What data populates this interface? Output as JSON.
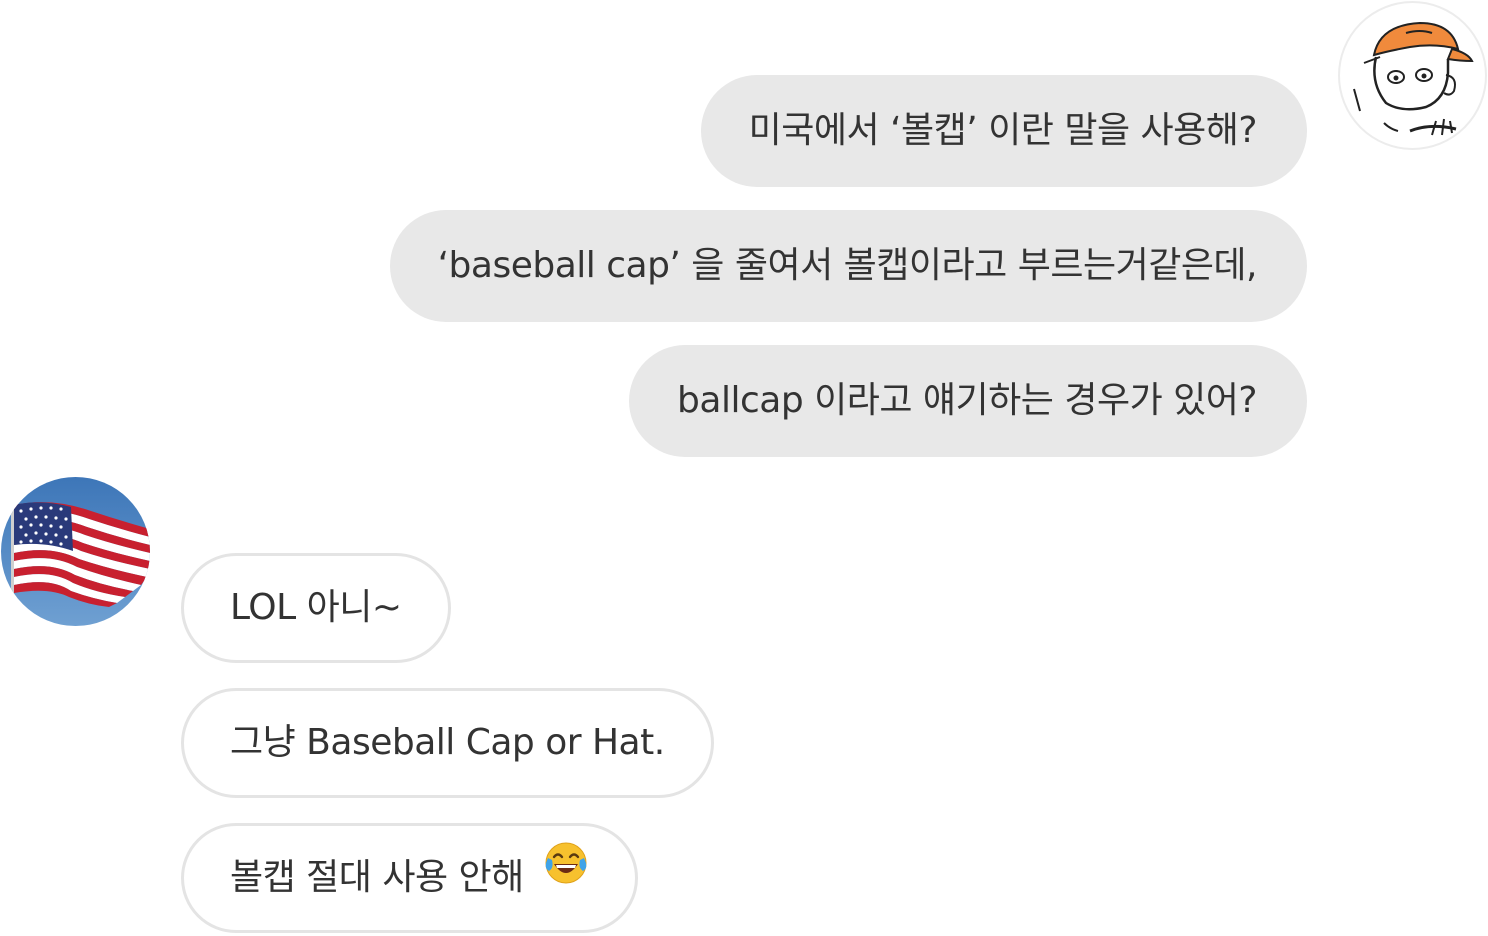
{
  "conversation": {
    "sent_messages": [
      "미국에서 ‘볼캡’ 이란 말을 사용해?",
      "‘baseball cap’ 을 줄여서 볼캡이라고 부르는거같은데,",
      "ballcap 이라고 얘기하는 경우가 있어?"
    ],
    "received_messages": [
      "LOL 아니~",
      "그냥 Baseball Cap or Hat.",
      "볼캡 절대 사용 안해"
    ],
    "received_last_emoji": "face-with-tears-of-joy-icon"
  },
  "avatars": {
    "me": "cartoon-cap-avatar-icon",
    "other": "us-flag-avatar-icon"
  },
  "colors": {
    "sent_bubble": "#e8e8e8",
    "received_border": "#e4e4e4",
    "text": "#333333",
    "cap_orange": "#f08a3c",
    "sky_blue": "#4a82c0"
  }
}
